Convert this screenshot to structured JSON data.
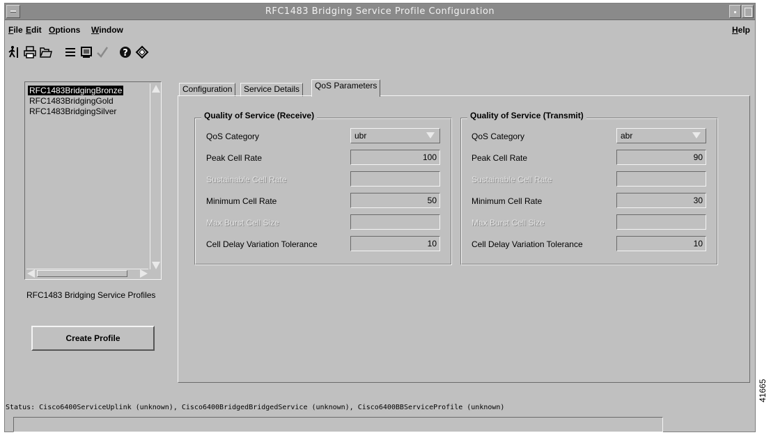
{
  "window": {
    "title": "RFC1483 Bridging Service Profile Configuration"
  },
  "menubar": {
    "file": "File",
    "edit": "Edit",
    "options": "Options",
    "window": "Window",
    "help": "Help"
  },
  "toolbar": {
    "icons": [
      "run-icon",
      "print-icon",
      "open-folder-icon",
      "list-icon",
      "screen-icon",
      "checkmark-icon",
      "help-icon",
      "refresh-icon"
    ]
  },
  "profiles": {
    "items": [
      "RFC1483BridgingBronze",
      "RFC1483BridgingGold",
      "RFC1483BridgingSilver"
    ],
    "selected": "RFC1483BridgingBronze",
    "caption": "RFC1483 Bridging Service Profiles",
    "create_label": "Create Profile"
  },
  "tabs": [
    "Configuration",
    "Service Details",
    "QoS Parameters"
  ],
  "active_tab": "QoS Parameters",
  "receive": {
    "title": "Quality of Service (Receive)",
    "qos_category_label": "QoS Category",
    "qos_category": "ubr",
    "pcr_label": "Peak Cell Rate",
    "pcr": "100",
    "scr_label": "Sustainable Cell Rate",
    "scr": "",
    "mcr_label": "Minimum Cell Rate",
    "mcr": "50",
    "mbs_label": "Max Burst Cell Size",
    "mbs": "",
    "cdvt_label": "Cell Delay Variation Tolerance",
    "cdvt": "10"
  },
  "transmit": {
    "title": "Quality of Service (Transmit)",
    "qos_category_label": "QoS Category",
    "qos_category": "abr",
    "pcr_label": "Peak Cell Rate",
    "pcr": "90",
    "scr_label": "Sustainable Cell Rate",
    "scr": "",
    "mcr_label": "Minimum Cell Rate",
    "mcr": "30",
    "mbs_label": "Max Burst Cell Size",
    "mbs": "",
    "cdvt_label": "Cell Delay Variation Tolerance",
    "cdvt": "10"
  },
  "status": {
    "text": "Status: Cisco6400ServiceUplink (unknown), Cisco6400BridgedBridgedService (unknown), Cisco6400BBServiceProfile (unknown)",
    "field_value": ""
  },
  "figure_id": "41665"
}
